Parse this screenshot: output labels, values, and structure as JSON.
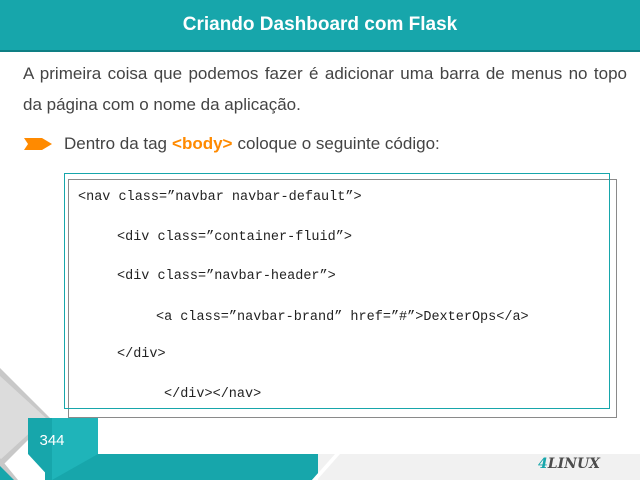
{
  "slide": {
    "title": "Criando Dashboard com Flask",
    "paragraph": "A primeira coisa que podemos fazer é adicionar uma barra de menus no topo da página com o nome da aplicação.",
    "bullet": {
      "before": "Dentro da tag",
      "tag": "<body>",
      "after": "coloque o seguinte código:"
    },
    "code_lines": [
      "<nav class=”navbar navbar-default”>",
      "<div class=”container-fluid”>",
      "<div class=”navbar-header”>",
      "<a class=”navbar-brand” href=”#”>DexterOps</a>",
      "</div>",
      "</div></nav>"
    ],
    "page_number": "344",
    "logo": {
      "prefix": "4",
      "name": "LINUX"
    }
  },
  "colors": {
    "accent": "#17a6ab",
    "orange": "#ff8a00",
    "text": "#444444"
  }
}
